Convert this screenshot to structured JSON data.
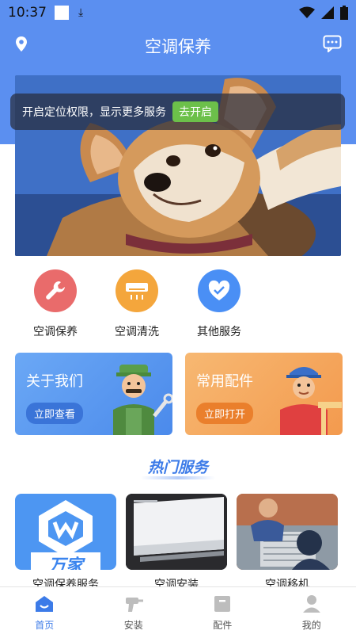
{
  "status_bar": {
    "time": "10:37"
  },
  "header": {
    "title": "空调保养",
    "location_icon": "location-pin-icon",
    "message_icon": "chat-bubble-icon"
  },
  "permission_banner": {
    "text": "开启定位权限，显示更多服务",
    "button": "去开启"
  },
  "services": [
    {
      "label": "空调保养",
      "icon": "wrench-icon",
      "color": "#e96b6b"
    },
    {
      "label": "空调清洗",
      "icon": "air-conditioner-icon",
      "color": "#f4a63c"
    },
    {
      "label": "其他服务",
      "icon": "heart-icon",
      "color": "#4a8ff5"
    }
  ],
  "cards": {
    "about": {
      "title": "关于我们",
      "button": "立即查看",
      "color": "#5b9cf2"
    },
    "parts": {
      "title": "常用配件",
      "button": "立即打开",
      "color": "#f5a45c"
    }
  },
  "hot_section": {
    "title": "热门服务"
  },
  "hot_items": [
    {
      "label": "空调保养服务",
      "logo_text": "万家"
    },
    {
      "label": "空调安装"
    },
    {
      "label": "空调移机"
    }
  ],
  "tabbar": [
    {
      "label": "首页",
      "icon": "home-icon",
      "active": true
    },
    {
      "label": "安装",
      "icon": "drill-icon",
      "active": false
    },
    {
      "label": "配件",
      "icon": "box-icon",
      "active": false
    },
    {
      "label": "我的",
      "icon": "user-icon",
      "active": false
    }
  ],
  "colors": {
    "primary": "#5b8ff0",
    "accent_green": "#6cc04a",
    "hot_title": "#3c7be8"
  }
}
